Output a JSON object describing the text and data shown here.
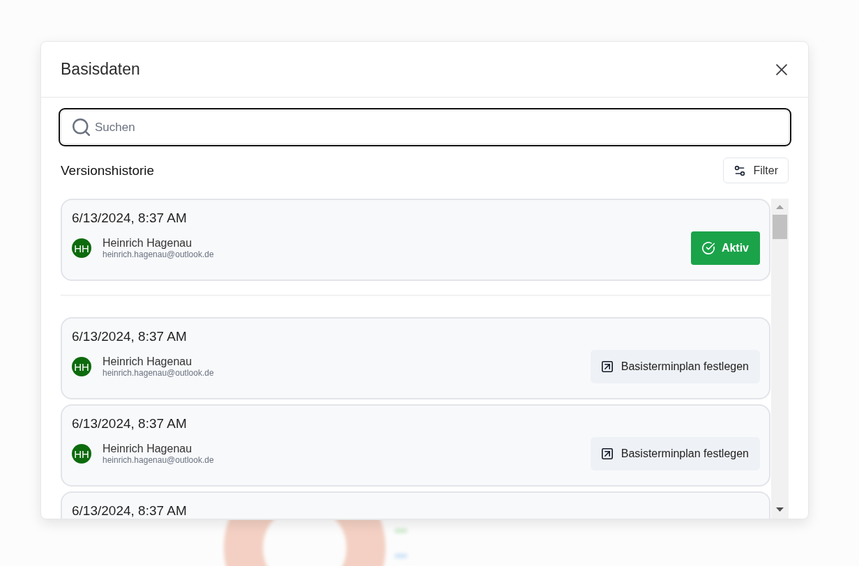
{
  "dialog": {
    "title": "Basisdaten",
    "search": {
      "placeholder": "Suchen"
    },
    "section_title": "Versionshistorie",
    "filter_button": {
      "label": "Filter"
    },
    "versions": [
      {
        "date": "6/13/2024, 8:37 AM",
        "user": {
          "initials": "HH",
          "name": "Heinrich Hagenau",
          "email": "heinrich.hagenau@outlook.de"
        },
        "active": true,
        "action": {
          "label": "Aktiv"
        }
      },
      {
        "date": "6/13/2024, 8:37 AM",
        "user": {
          "initials": "HH",
          "name": "Heinrich Hagenau",
          "email": "heinrich.hagenau@outlook.de"
        },
        "active": false,
        "action": {
          "label": "Basisterminplan festlegen"
        }
      },
      {
        "date": "6/13/2024, 8:37 AM",
        "user": {
          "initials": "HH",
          "name": "Heinrich Hagenau",
          "email": "heinrich.hagenau@outlook.de"
        },
        "active": false,
        "action": {
          "label": "Basisterminplan festlegen"
        }
      },
      {
        "date": "6/13/2024, 8:37 AM"
      }
    ]
  }
}
